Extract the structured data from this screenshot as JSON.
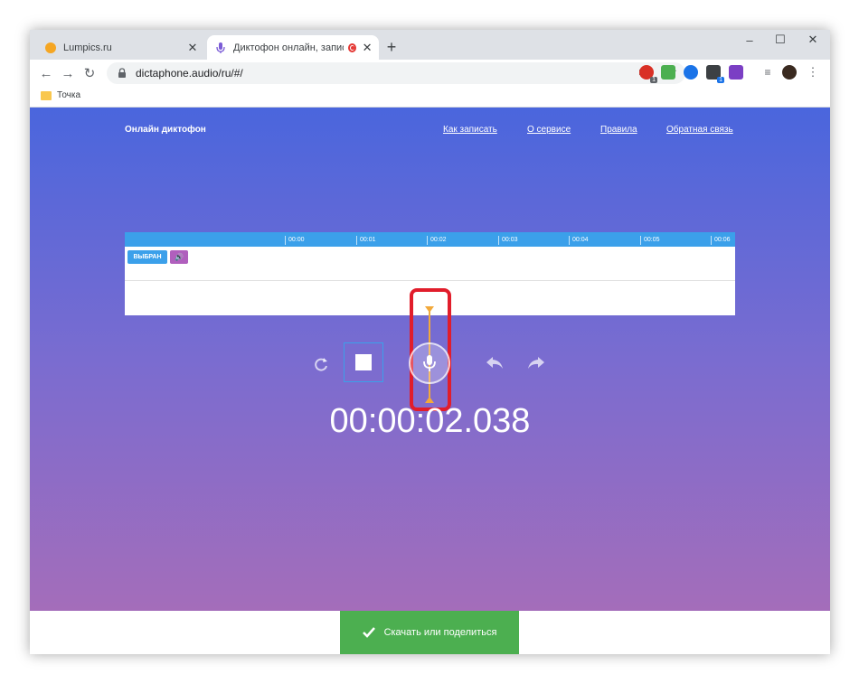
{
  "tabs": [
    {
      "title": "Lumpics.ru",
      "favicon": "orange-circle-icon"
    },
    {
      "title": "Диктофон онлайн, записать",
      "favicon": "microphone-icon",
      "recording": true
    }
  ],
  "window_controls": {
    "minimize": "–",
    "maximize": "☐",
    "close": "✕"
  },
  "toolbar": {
    "url": "dictaphone.audio/ru/#/"
  },
  "bookmarks": [
    {
      "label": "Точка"
    }
  ],
  "site": {
    "brand": "Онлайн диктофон",
    "nav": [
      "Как записать",
      "О сервисе",
      "Правила",
      "Обратная связь"
    ]
  },
  "timeline": {
    "ticks": [
      "00:00",
      "00:01",
      "00:02",
      "00:03",
      "00:04",
      "00:05",
      "00:06"
    ],
    "track_button": "ВЫБРАН",
    "playhead_seconds": 2.038
  },
  "timer": "00:00:02.038",
  "download_button": "Скачать или поделиться",
  "colors": {
    "accent": "#3ba0ea",
    "playhead": "#f2a93b",
    "highlight": "#e11d2b",
    "download": "#4caf50"
  }
}
